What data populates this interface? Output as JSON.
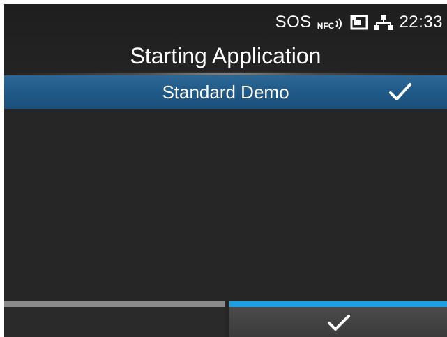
{
  "status_bar": {
    "sos_label": "SOS",
    "nfc_label": "NFC",
    "time": "22:33",
    "icons": [
      "nfc-icon",
      "sd-card-icon",
      "network-icon"
    ]
  },
  "header": {
    "title": "Starting Application"
  },
  "list": {
    "items": [
      {
        "label": "Standard Demo",
        "selected": true,
        "icon": "checkmark-icon"
      }
    ]
  },
  "footer": {
    "left_button": {
      "label": ""
    },
    "right_button": {
      "icon": "checkmark-icon"
    }
  },
  "colors": {
    "background": "#262626",
    "selection": "#205a88",
    "accent_bar": "#1ba1e2",
    "inactive_bar": "#8a8a8a",
    "text": "#ffffff"
  }
}
